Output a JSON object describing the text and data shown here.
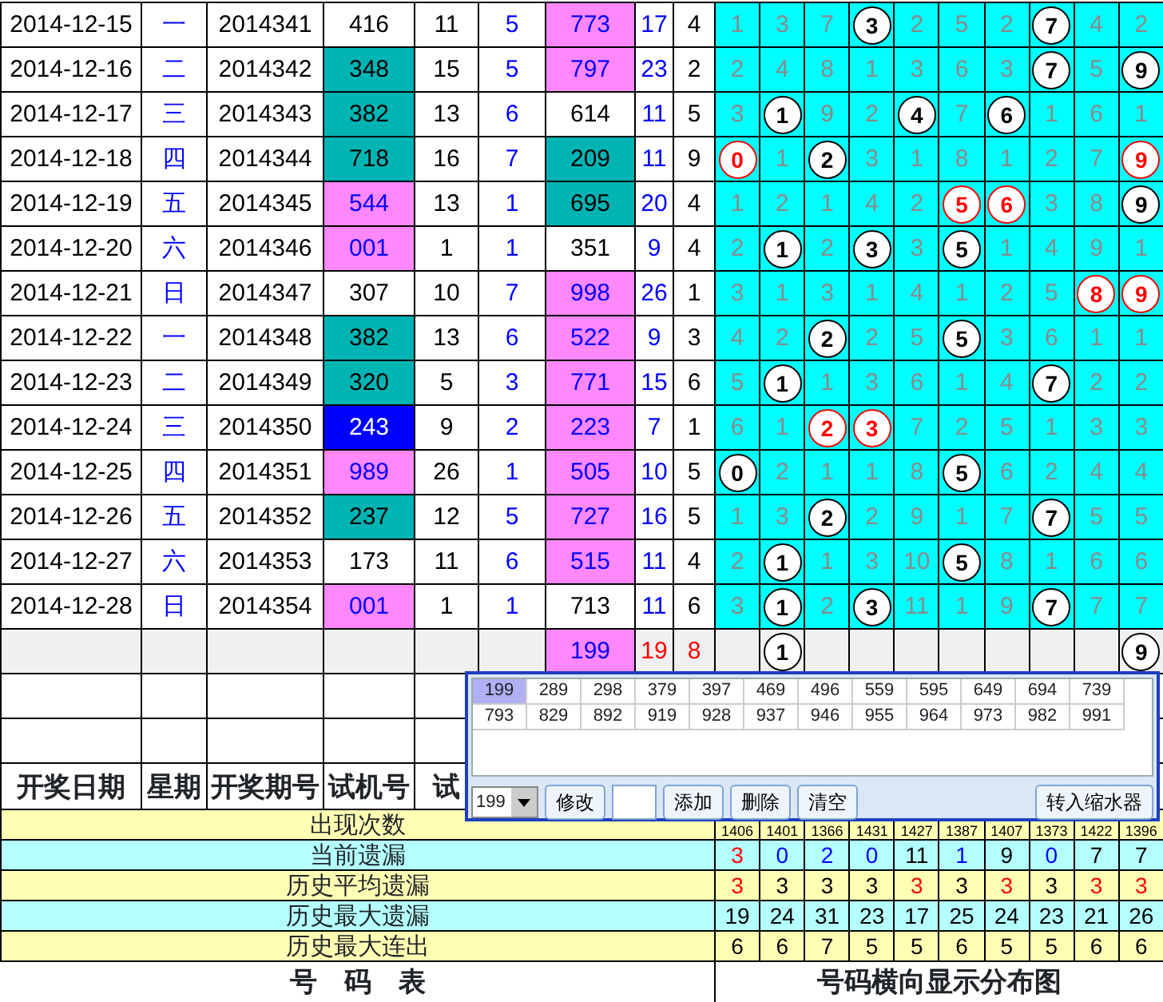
{
  "rows": [
    {
      "cells": [
        "2014-12-15",
        "一",
        "2014341",
        "416",
        "11",
        "5",
        {
          "text": "773",
          "color": "#ff88ff"
        },
        "17",
        "4"
      ],
      "dist": [
        {
          "text": "1",
          "hit": false
        },
        {
          "text": "3",
          "hit": false
        },
        {
          "text": "7",
          "hit": false
        },
        {
          "text": "3",
          "hit": true,
          "color": "#000000"
        },
        {
          "text": "2",
          "hit": false
        },
        {
          "text": "5",
          "hit": false
        },
        {
          "text": "2",
          "hit": false
        },
        {
          "text": "7",
          "hit": true,
          "color": "#000000"
        },
        {
          "text": "4",
          "hit": false
        },
        {
          "text": "2",
          "hit": false
        }
      ]
    },
    {
      "cells": [
        "2014-12-16",
        "二",
        "2014342",
        {
          "text": "348",
          "color": "#00b4b4"
        },
        "15",
        "5",
        {
          "text": "797",
          "color": "#ff88ff"
        },
        "23",
        "2"
      ],
      "dist": [
        {
          "text": "2",
          "hit": false
        },
        {
          "text": "4",
          "hit": false
        },
        {
          "text": "8",
          "hit": false
        },
        {
          "text": "1",
          "hit": false
        },
        {
          "text": "3",
          "hit": false
        },
        {
          "text": "6",
          "hit": false
        },
        {
          "text": "3",
          "hit": false
        },
        {
          "text": "7",
          "hit": true,
          "color": "#000000"
        },
        {
          "text": "5",
          "hit": false
        },
        {
          "text": "9",
          "hit": true,
          "color": "#000000"
        }
      ]
    },
    {
      "cells": [
        "2014-12-17",
        "三",
        "2014343",
        {
          "text": "382",
          "color": "#00b4b4"
        },
        "13",
        "6",
        "614",
        "11",
        "5"
      ],
      "dist": [
        {
          "text": "3",
          "hit": false
        },
        {
          "text": "1",
          "hit": true,
          "color": "#000000"
        },
        {
          "text": "9",
          "hit": false
        },
        {
          "text": "2",
          "hit": false
        },
        {
          "text": "4",
          "hit": true,
          "color": "#000000"
        },
        {
          "text": "7",
          "hit": false
        },
        {
          "text": "6",
          "hit": true,
          "color": "#000000"
        },
        {
          "text": "1",
          "hit": false
        },
        {
          "text": "6",
          "hit": false
        },
        {
          "text": "1",
          "hit": false
        }
      ]
    },
    {
      "cells": [
        "2014-12-18",
        "四",
        "2014344",
        {
          "text": "718",
          "color": "#00b4b4"
        },
        "16",
        "7",
        {
          "text": "209",
          "color": "#00b4b4"
        },
        "11",
        "9"
      ],
      "dist": [
        {
          "text": "0",
          "hit": true,
          "color": "#ff0000"
        },
        {
          "text": "1",
          "hit": false
        },
        {
          "text": "2",
          "hit": true,
          "color": "#000000"
        },
        {
          "text": "3",
          "hit": false
        },
        {
          "text": "1",
          "hit": false
        },
        {
          "text": "8",
          "hit": false
        },
        {
          "text": "1",
          "hit": false
        },
        {
          "text": "2",
          "hit": false
        },
        {
          "text": "7",
          "hit": false
        },
        {
          "text": "9",
          "hit": true,
          "color": "#ff0000"
        }
      ]
    },
    {
      "cells": [
        "2014-12-19",
        "五",
        "2014345",
        {
          "text": "544",
          "color": "#ff88ff"
        },
        "13",
        "1",
        {
          "text": "695",
          "color": "#00b4b4"
        },
        "20",
        "4"
      ],
      "dist": [
        {
          "text": "1",
          "hit": false
        },
        {
          "text": "2",
          "hit": false
        },
        {
          "text": "1",
          "hit": false
        },
        {
          "text": "4",
          "hit": false
        },
        {
          "text": "2",
          "hit": false
        },
        {
          "text": "5",
          "hit": true,
          "color": "#ff0000"
        },
        {
          "text": "6",
          "hit": true,
          "color": "#ff0000"
        },
        {
          "text": "3",
          "hit": false
        },
        {
          "text": "8",
          "hit": false
        },
        {
          "text": "9",
          "hit": true,
          "color": "#000000"
        }
      ]
    },
    {
      "cells": [
        "2014-12-20",
        "六",
        "2014346",
        {
          "text": "001",
          "color": "#ff88ff"
        },
        "1",
        "1",
        "351",
        "9",
        "4"
      ],
      "dist": [
        {
          "text": "2",
          "hit": false
        },
        {
          "text": "1",
          "hit": true,
          "color": "#000000"
        },
        {
          "text": "2",
          "hit": false
        },
        {
          "text": "3",
          "hit": true,
          "color": "#000000"
        },
        {
          "text": "3",
          "hit": false
        },
        {
          "text": "5",
          "hit": true,
          "color": "#000000"
        },
        {
          "text": "1",
          "hit": false
        },
        {
          "text": "4",
          "hit": false
        },
        {
          "text": "9",
          "hit": false
        },
        {
          "text": "1",
          "hit": false
        }
      ]
    },
    {
      "cells": [
        "2014-12-21",
        "日",
        "2014347",
        "307",
        "10",
        "7",
        {
          "text": "998",
          "color": "#ff88ff"
        },
        "26",
        "1"
      ],
      "dist": [
        {
          "text": "3",
          "hit": false
        },
        {
          "text": "1",
          "hit": false
        },
        {
          "text": "3",
          "hit": false
        },
        {
          "text": "1",
          "hit": false
        },
        {
          "text": "4",
          "hit": false
        },
        {
          "text": "1",
          "hit": false
        },
        {
          "text": "2",
          "hit": false
        },
        {
          "text": "5",
          "hit": false
        },
        {
          "text": "8",
          "hit": true,
          "color": "#ff0000"
        },
        {
          "text": "9",
          "hit": true,
          "color": "#ff0000"
        }
      ]
    },
    {
      "cells": [
        "2014-12-22",
        "一",
        "2014348",
        {
          "text": "382",
          "color": "#00b4b4"
        },
        "13",
        "6",
        {
          "text": "522",
          "color": "#ff88ff"
        },
        "9",
        "3"
      ],
      "dist": [
        {
          "text": "4",
          "hit": false
        },
        {
          "text": "2",
          "hit": false
        },
        {
          "text": "2",
          "hit": true,
          "color": "#000000"
        },
        {
          "text": "2",
          "hit": false
        },
        {
          "text": "5",
          "hit": false
        },
        {
          "text": "5",
          "hit": true,
          "color": "#000000"
        },
        {
          "text": "3",
          "hit": false
        },
        {
          "text": "6",
          "hit": false
        },
        {
          "text": "1",
          "hit": false
        },
        {
          "text": "1",
          "hit": false
        }
      ]
    },
    {
      "cells": [
        "2014-12-23",
        "二",
        "2014349",
        {
          "text": "320",
          "color": "#00b4b4"
        },
        "5",
        "3",
        {
          "text": "771",
          "color": "#ff88ff"
        },
        "15",
        "6"
      ],
      "dist": [
        {
          "text": "5",
          "hit": false
        },
        {
          "text": "1",
          "hit": true,
          "color": "#000000"
        },
        {
          "text": "1",
          "hit": false
        },
        {
          "text": "3",
          "hit": false
        },
        {
          "text": "6",
          "hit": false
        },
        {
          "text": "1",
          "hit": false
        },
        {
          "text": "4",
          "hit": false
        },
        {
          "text": "7",
          "hit": true,
          "color": "#000000"
        },
        {
          "text": "2",
          "hit": false
        },
        {
          "text": "2",
          "hit": false
        }
      ]
    },
    {
      "cells": [
        "2014-12-24",
        "三",
        "2014350",
        {
          "text": "243",
          "color": "#0000ff"
        },
        "9",
        "2",
        {
          "text": "223",
          "color": "#ff88ff"
        },
        "7",
        "1"
      ],
      "dist": [
        {
          "text": "6",
          "hit": false
        },
        {
          "text": "1",
          "hit": false
        },
        {
          "text": "2",
          "hit": true,
          "color": "#ff0000"
        },
        {
          "text": "3",
          "hit": true,
          "color": "#ff0000"
        },
        {
          "text": "7",
          "hit": false
        },
        {
          "text": "2",
          "hit": false
        },
        {
          "text": "5",
          "hit": false
        },
        {
          "text": "1",
          "hit": false
        },
        {
          "text": "3",
          "hit": false
        },
        {
          "text": "3",
          "hit": false
        }
      ]
    },
    {
      "cells": [
        "2014-12-25",
        "四",
        "2014351",
        {
          "text": "989",
          "color": "#ff88ff"
        },
        "26",
        "1",
        {
          "text": "505",
          "color": "#ff88ff"
        },
        "10",
        "5"
      ],
      "dist": [
        {
          "text": "0",
          "hit": true,
          "color": "#000000"
        },
        {
          "text": "2",
          "hit": false
        },
        {
          "text": "1",
          "hit": false
        },
        {
          "text": "1",
          "hit": false
        },
        {
          "text": "8",
          "hit": false
        },
        {
          "text": "5",
          "hit": true,
          "color": "#000000"
        },
        {
          "text": "6",
          "hit": false
        },
        {
          "text": "2",
          "hit": false
        },
        {
          "text": "4",
          "hit": false
        },
        {
          "text": "4",
          "hit": false
        }
      ]
    },
    {
      "cells": [
        "2014-12-26",
        "五",
        "2014352",
        {
          "text": "237",
          "color": "#00b4b4"
        },
        "12",
        "5",
        {
          "text": "727",
          "color": "#ff88ff"
        },
        "16",
        "5"
      ],
      "dist": [
        {
          "text": "1",
          "hit": false
        },
        {
          "text": "3",
          "hit": false
        },
        {
          "text": "2",
          "hit": true,
          "color": "#000000"
        },
        {
          "text": "2",
          "hit": false
        },
        {
          "text": "9",
          "hit": false
        },
        {
          "text": "1",
          "hit": false
        },
        {
          "text": "7",
          "hit": false
        },
        {
          "text": "7",
          "hit": true,
          "color": "#000000"
        },
        {
          "text": "5",
          "hit": false
        },
        {
          "text": "5",
          "hit": false
        }
      ]
    },
    {
      "cells": [
        "2014-12-27",
        "六",
        "2014353",
        "173",
        "11",
        "6",
        {
          "text": "515",
          "color": "#ff88ff"
        },
        "11",
        "4"
      ],
      "dist": [
        {
          "text": "2",
          "hit": false
        },
        {
          "text": "1",
          "hit": true,
          "color": "#000000"
        },
        {
          "text": "1",
          "hit": false
        },
        {
          "text": "3",
          "hit": false
        },
        {
          "text": "10",
          "hit": false
        },
        {
          "text": "5",
          "hit": true,
          "color": "#000000"
        },
        {
          "text": "8",
          "hit": false
        },
        {
          "text": "1",
          "hit": false
        },
        {
          "text": "6",
          "hit": false
        },
        {
          "text": "6",
          "hit": false
        }
      ]
    },
    {
      "cells": [
        "2014-12-28",
        "日",
        "2014354",
        {
          "text": "001",
          "color": "#ff88ff"
        },
        "1",
        "1",
        "713",
        "11",
        "6"
      ],
      "dist": [
        {
          "text": "3",
          "hit": false
        },
        {
          "text": "1",
          "hit": true,
          "color": "#000000"
        },
        {
          "text": "2",
          "hit": false
        },
        {
          "text": "3",
          "hit": true,
          "color": "#000000"
        },
        {
          "text": "11",
          "hit": false
        },
        {
          "text": "1",
          "hit": false
        },
        {
          "text": "9",
          "hit": false
        },
        {
          "text": "7",
          "hit": true,
          "color": "#000000"
        },
        {
          "text": "7",
          "hit": false
        },
        {
          "text": "7",
          "hit": false
        }
      ]
    },
    {
      "kind": "summary",
      "draw": {
        "text": "199",
        "color": "#ff88ff"
      },
      "column_8": "19",
      "column_9": "8",
      "dist": [
        {
          "hit": false
        },
        {
          "text": "1",
          "hit": true,
          "color": "#000000"
        },
        {
          "hit": false
        },
        {
          "hit": false
        },
        {
          "hit": false
        },
        {
          "hit": false
        },
        {
          "hit": false
        },
        {
          "hit": false
        },
        {
          "hit": false
        },
        {
          "text": "9",
          "hit": true,
          "color": "#000000"
        }
      ]
    }
  ],
  "header": [
    "开奖日期",
    "星期",
    "开奖期号",
    "试机号",
    "试"
  ],
  "stats": [
    {
      "label": "出现次数",
      "values": [
        {
          "text": "1406",
          "color": "#000000"
        },
        {
          "text": "1401",
          "color": "#000000"
        },
        {
          "text": "1366",
          "color": "#000000"
        },
        {
          "text": "1431",
          "color": "#000000"
        },
        {
          "text": "1427",
          "color": "#000000"
        },
        {
          "text": "1387",
          "color": "#000000"
        },
        {
          "text": "1407",
          "color": "#000000"
        },
        {
          "text": "1373",
          "color": "#000000"
        },
        {
          "text": "1422",
          "color": "#000000"
        },
        {
          "text": "1396",
          "color": "#000000"
        }
      ]
    },
    {
      "label": "当前遗漏",
      "values": [
        {
          "text": "3",
          "color": "#ff0000"
        },
        {
          "text": "0",
          "color": "#0000ff"
        },
        {
          "text": "2",
          "color": "#0000ff"
        },
        {
          "text": "0",
          "color": "#0000ff"
        },
        {
          "text": "11",
          "color": "#000000"
        },
        {
          "text": "1",
          "color": "#0000ff"
        },
        {
          "text": "9",
          "color": "#000000"
        },
        {
          "text": "0",
          "color": "#0000ff"
        },
        {
          "text": "7",
          "color": "#000000"
        },
        {
          "text": "7",
          "color": "#000000"
        }
      ]
    },
    {
      "label": "历史平均遗漏",
      "values": [
        {
          "text": "3",
          "color": "#ff0000"
        },
        {
          "text": "3",
          "color": "#000000"
        },
        {
          "text": "3",
          "color": "#000000"
        },
        {
          "text": "3",
          "color": "#000000"
        },
        {
          "text": "3",
          "color": "#ff0000"
        },
        {
          "text": "3",
          "color": "#000000"
        },
        {
          "text": "3",
          "color": "#ff0000"
        },
        {
          "text": "3",
          "color": "#000000"
        },
        {
          "text": "3",
          "color": "#ff0000"
        },
        {
          "text": "3",
          "color": "#ff0000"
        }
      ]
    },
    {
      "label": "历史最大遗漏",
      "values": [
        {
          "text": "19",
          "color": "#000000"
        },
        {
          "text": "24",
          "color": "#000000"
        },
        {
          "text": "31",
          "color": "#000000"
        },
        {
          "text": "23",
          "color": "#000000"
        },
        {
          "text": "17",
          "color": "#000000"
        },
        {
          "text": "25",
          "color": "#000000"
        },
        {
          "text": "24",
          "color": "#000000"
        },
        {
          "text": "23",
          "color": "#000000"
        },
        {
          "text": "21",
          "color": "#000000"
        },
        {
          "text": "26",
          "color": "#000000"
        }
      ]
    },
    {
      "label": "历史最大连出",
      "values": [
        {
          "text": "6",
          "color": "#000000"
        },
        {
          "text": "6",
          "color": "#000000"
        },
        {
          "text": "7",
          "color": "#000000"
        },
        {
          "text": "5",
          "color": "#000000"
        },
        {
          "text": "5",
          "color": "#000000"
        },
        {
          "text": "6",
          "color": "#000000"
        },
        {
          "text": "5",
          "color": "#000000"
        },
        {
          "text": "5",
          "color": "#000000"
        },
        {
          "text": "6",
          "color": "#000000"
        },
        {
          "text": "6",
          "color": "#000000"
        }
      ]
    }
  ],
  "footer": {
    "left": "号　码　表",
    "right": "号码横向显示分布图"
  },
  "popup": {
    "numbers": [
      {
        "text": "199",
        "selected": true
      },
      {
        "text": "289",
        "selected": false
      },
      {
        "text": "298",
        "selected": false
      },
      {
        "text": "379",
        "selected": false
      },
      {
        "text": "397",
        "selected": false
      },
      {
        "text": "469",
        "selected": false
      },
      {
        "text": "496",
        "selected": false
      },
      {
        "text": "559",
        "selected": false
      },
      {
        "text": "595",
        "selected": false
      },
      {
        "text": "649",
        "selected": false
      },
      {
        "text": "694",
        "selected": false
      },
      {
        "text": "739",
        "selected": false
      },
      {
        "text": "793",
        "selected": false
      },
      {
        "text": "829",
        "selected": false
      },
      {
        "text": "892",
        "selected": false
      },
      {
        "text": "919",
        "selected": false
      },
      {
        "text": "928",
        "selected": false
      },
      {
        "text": "937",
        "selected": false
      },
      {
        "text": "946",
        "selected": false
      },
      {
        "text": "955",
        "selected": false
      },
      {
        "text": "964",
        "selected": false
      },
      {
        "text": "973",
        "selected": false
      },
      {
        "text": "982",
        "selected": false
      },
      {
        "text": "991",
        "selected": false
      }
    ],
    "dropdown_value": "199",
    "buttons": [
      "修改",
      "添加",
      "删除",
      "清空",
      "转入缩水器"
    ]
  }
}
